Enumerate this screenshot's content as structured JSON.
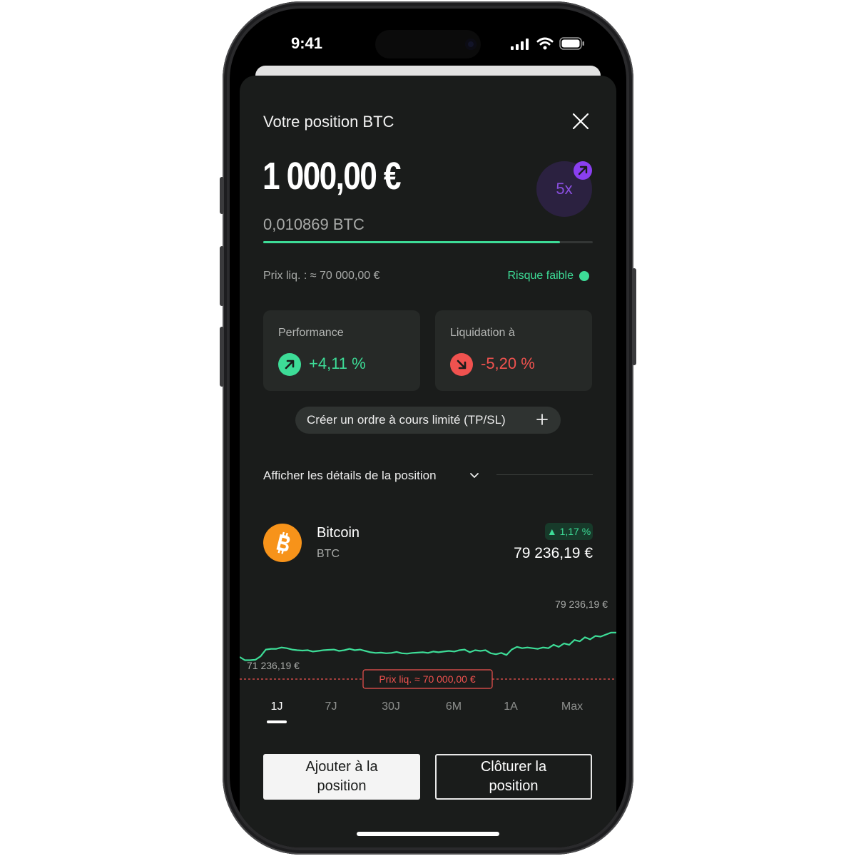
{
  "status_bar": {
    "time": "9:41"
  },
  "sheet": {
    "title": "Votre position BTC",
    "amount": "1 000,00 €",
    "amount_btc": "0,010869 BTC",
    "leverage": "5x",
    "liquidation_price": "Prix liq. : ≈ 70 000,00 €",
    "risk_label": "Risque faible",
    "risk_level": 0.9,
    "cards": [
      {
        "label": "Performance",
        "value": "+4,11 %",
        "color": "#3ddc97"
      },
      {
        "label": "Liquidation à",
        "value": "-5,20 %",
        "color": "#f0524f"
      }
    ],
    "limit_order_label": "Créer un ordre à cours limité (TP/SL)",
    "details_label": "Afficher les détails de la position"
  },
  "asset": {
    "name": "Bitcoin",
    "symbol": "BTC",
    "change": "▲ 1,17 %",
    "price": "79 236,19 €"
  },
  "chart_data": {
    "type": "line",
    "high_label": "79 236,19 €",
    "low_label": "71 236,19 €",
    "liquidation_label": "Prix liq. ≈ 70 000,00 €",
    "liquidation_value": 70000,
    "ylim": [
      69500,
      80000
    ],
    "values": [
      71700,
      71236,
      71236,
      71300,
      71800,
      72800,
      72900,
      72900,
      73100,
      73000,
      72800,
      72700,
      72650,
      72700,
      72500,
      72600,
      72700,
      72750,
      72800,
      72600,
      72700,
      72900,
      72700,
      72800,
      72600,
      72400,
      72300,
      72350,
      72250,
      72300,
      72450,
      72250,
      72200,
      72300,
      72350,
      72400,
      72300,
      72500,
      72400,
      72500,
      72600,
      72500,
      72700,
      72800,
      72400,
      72700,
      72600,
      72700,
      72250,
      72100,
      72300,
      72000,
      72800,
      73200,
      73000,
      73100,
      73000,
      72900,
      73100,
      73000,
      73500,
      73200,
      73700,
      73500,
      74200,
      74000,
      74600,
      74300,
      74800,
      74700,
      75000,
      75300,
      75300
    ]
  },
  "ranges": [
    {
      "label": "1J",
      "active": true
    },
    {
      "label": "7J",
      "active": false
    },
    {
      "label": "30J",
      "active": false
    },
    {
      "label": "6M",
      "active": false
    },
    {
      "label": "1A",
      "active": false
    },
    {
      "label": "Max",
      "active": false
    }
  ],
  "actions": {
    "add_label": "Ajouter à la position",
    "close_label": "Clôturer la position"
  },
  "colors": {
    "positive": "#3ddc97",
    "negative": "#f0524f",
    "leverage": "#8a3ff0",
    "btc": "#f7931a"
  }
}
